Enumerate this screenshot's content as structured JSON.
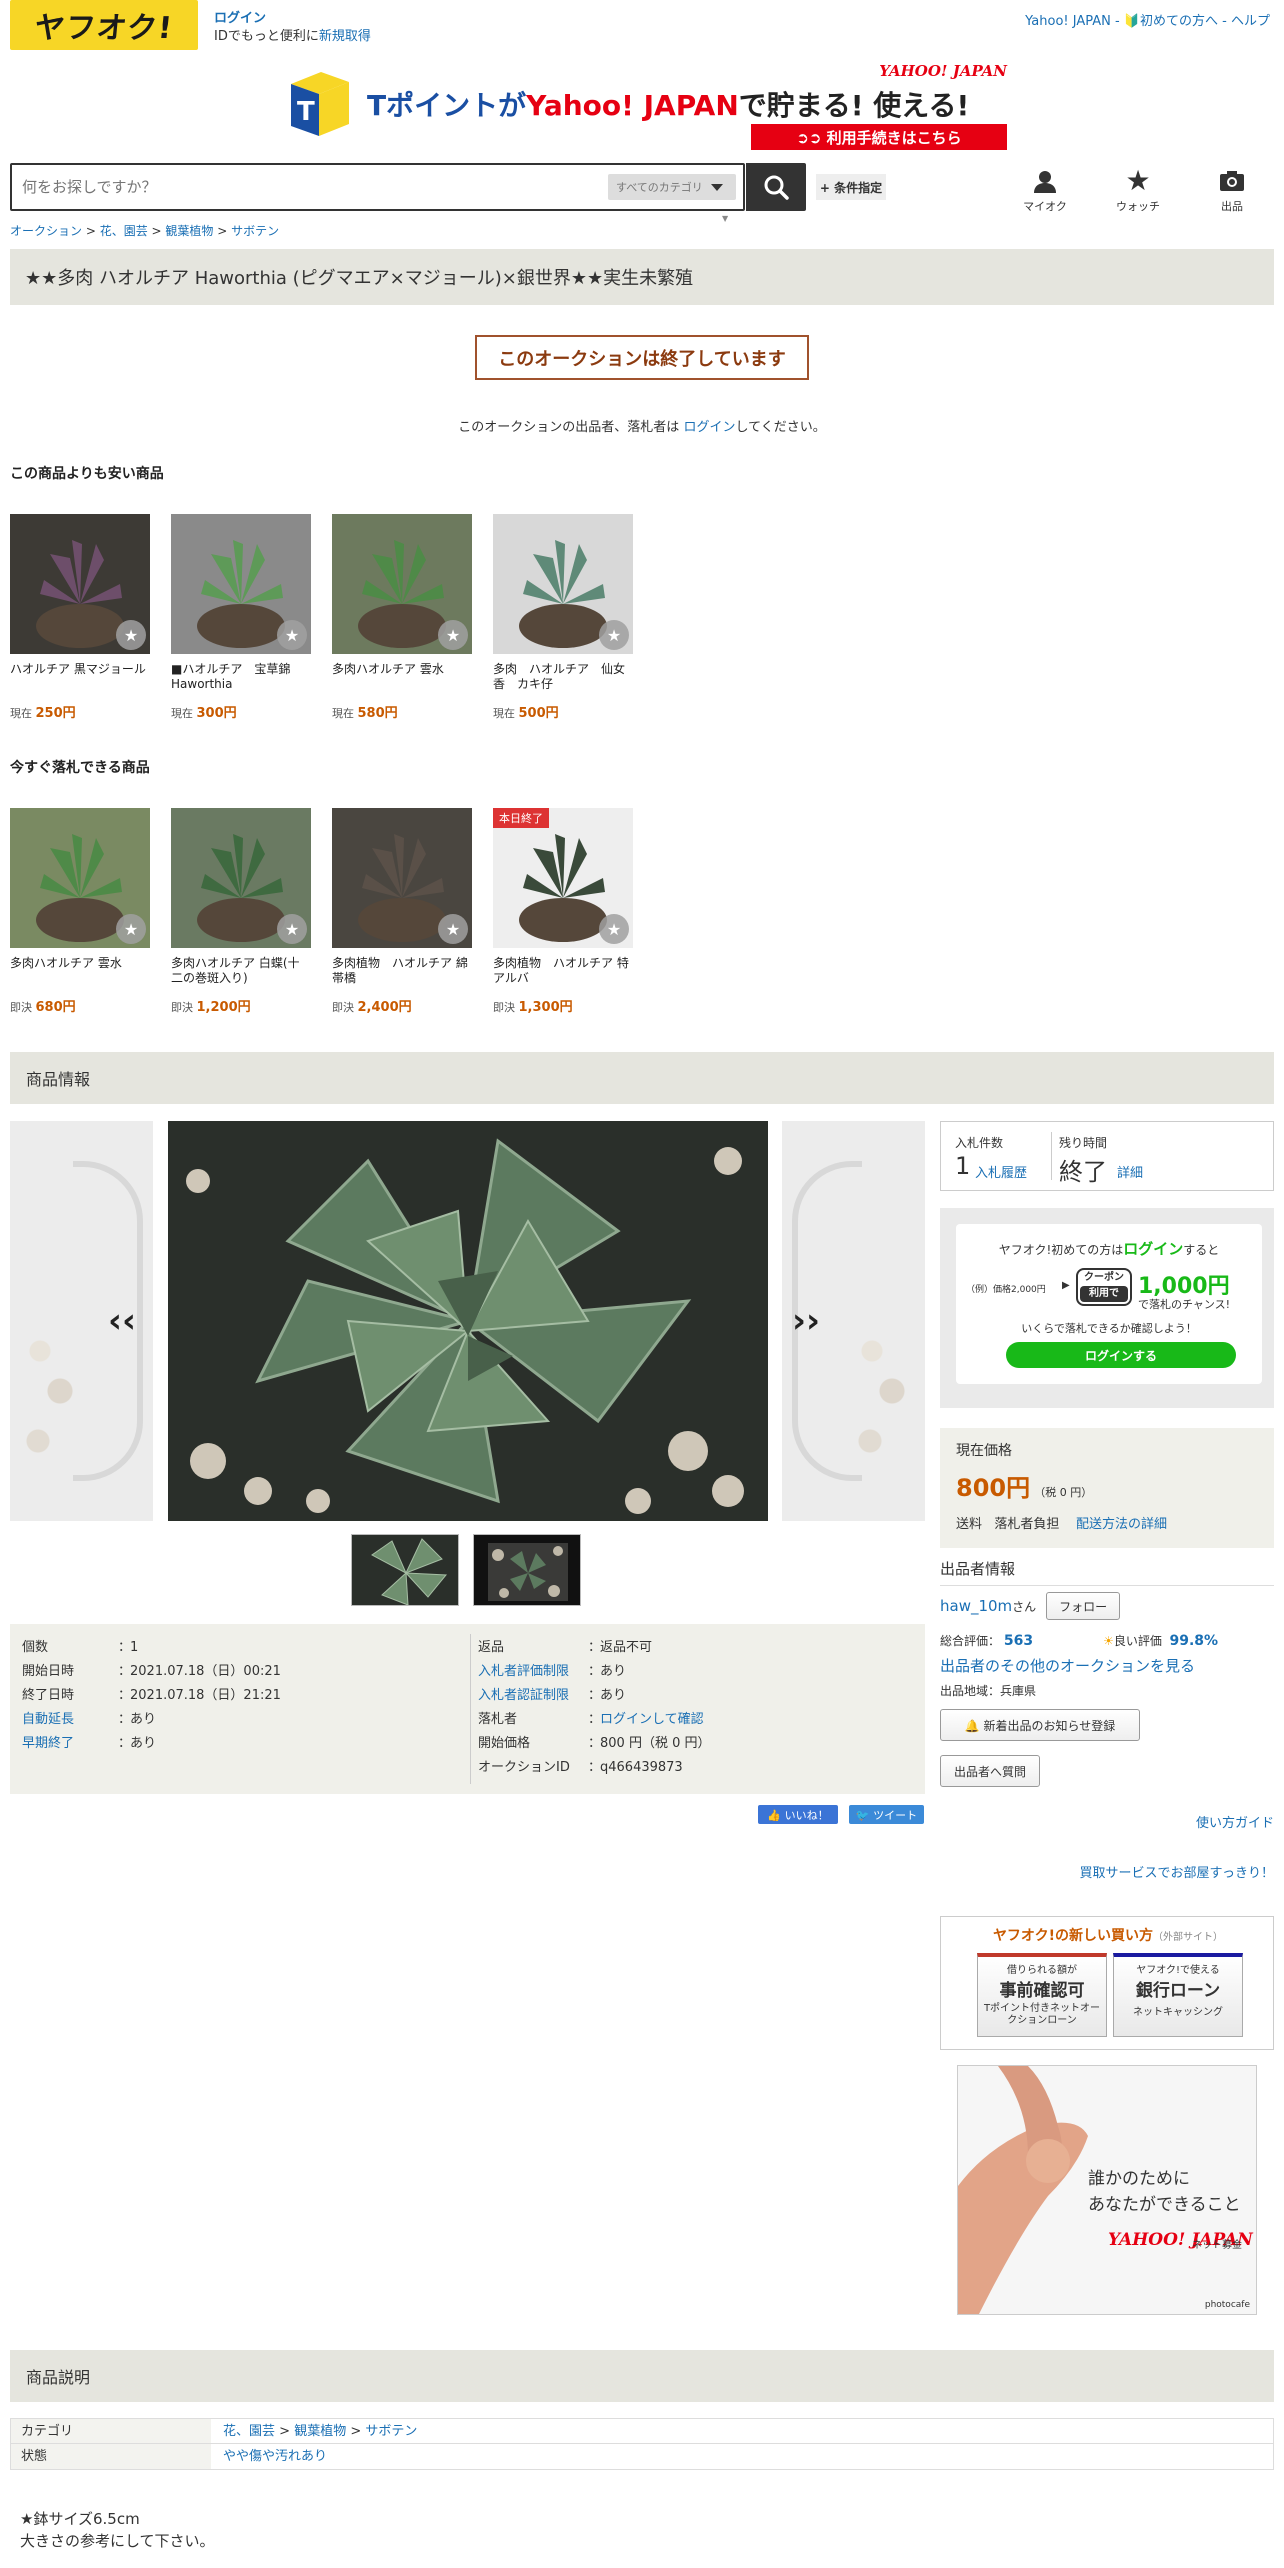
{
  "header": {
    "logo_text": "ヤフオク!",
    "login_link": "ログイン",
    "login_sub_prefix": "IDでもっと便利に",
    "signup_link": "新規取得",
    "right_links": "Yahoo! JAPAN - 🔰初めての方へ - ヘルプ"
  },
  "banner": {
    "brand": "YAHOO! JAPAN",
    "headline_a": "Tポイントが",
    "headline_b": "Yahoo! JAPAN",
    "headline_c": "で貯まる! 使える!",
    "cta": "➲➲ 利用手続きはこちら"
  },
  "search": {
    "placeholder": "何をお探しですか？",
    "category": "すべてのカテゴリ",
    "conditions": "+ 条件指定"
  },
  "nav": {
    "myauc": "マイオク",
    "watch": "ウォッチ",
    "sell": "出品"
  },
  "breadcrumb": [
    "オークション",
    "花、園芸",
    "観葉植物",
    "サボテン"
  ],
  "title": "★★多肉 ハオルチア Haworthia (ピグマエア×マジョール)×銀世界★★実生未繁殖",
  "ended_text": "このオークションは終了しています",
  "login_msg_a": "このオークションの出品者、落札者は",
  "login_msg_link": "ログイン",
  "login_msg_b": "してください。",
  "cheaper": {
    "heading": "この商品よりも安い商品",
    "items": [
      {
        "name": "ハオルチア 黒マジョール",
        "label": "現在",
        "price": "250円"
      },
      {
        "name": "■ハオルチア　宝草錦 Haworthia",
        "label": "現在",
        "price": "300円"
      },
      {
        "name": "多肉ハオルチア 雲水",
        "label": "現在",
        "price": "580円"
      },
      {
        "name": "多肉　ハオルチア　仙女香　カキ仔",
        "label": "現在",
        "price": "500円"
      }
    ]
  },
  "buynow": {
    "heading": "今すぐ落札できる商品",
    "items": [
      {
        "name": "多肉ハオルチア 雲水",
        "label": "即決",
        "price": "680円",
        "tag": ""
      },
      {
        "name": "多肉ハオルチア 白蝶(十二の巻斑入り)",
        "label": "即決",
        "price": "1,200円",
        "tag": ""
      },
      {
        "name": "多肉植物　ハオルチア 綿帯橋",
        "label": "即決",
        "price": "2,400円",
        "tag": ""
      },
      {
        "name": "多肉植物　ハオルチア 特アルバ",
        "label": "即決",
        "price": "1,300円",
        "tag": "本日終了"
      }
    ]
  },
  "info_heading": "商品情報",
  "specs_left": [
    {
      "k": "個数",
      "v": "1",
      "link": false
    },
    {
      "k": "開始日時",
      "v": "2021.07.18（日）00:21",
      "link": false
    },
    {
      "k": "終了日時",
      "v": "2021.07.18（日）21:21",
      "link": false
    },
    {
      "k": "自動延長",
      "v": "あり",
      "link": true
    },
    {
      "k": "早期終了",
      "v": "あり",
      "link": true
    }
  ],
  "specs_right": [
    {
      "k": "返品",
      "v": "返品不可",
      "link": false,
      "vlink": false
    },
    {
      "k": "入札者評価制限",
      "v": "あり",
      "link": true,
      "vlink": false
    },
    {
      "k": "入札者認証制限",
      "v": "あり",
      "link": true,
      "vlink": false
    },
    {
      "k": "落札者",
      "v": "ログインして確認",
      "link": false,
      "vlink": true
    },
    {
      "k": "開始価格",
      "v": "800 円（税 0 円）",
      "link": false,
      "vlink": false
    },
    {
      "k": "オークションID",
      "v": "q466439873",
      "link": false,
      "vlink": false
    }
  ],
  "share": {
    "like": "👍 いいね！",
    "tweet": "🐦 ツイート"
  },
  "bid": {
    "count_label": "入札件数",
    "count": "1",
    "history": "入札履歴",
    "time_label": "残り時間",
    "time": "終了",
    "detail": "詳細"
  },
  "promo": {
    "line1_a": "ヤフオク!初めての方は",
    "line1_b": "ログイン",
    "line1_c": "すると",
    "example": "（例）価格2,000円",
    "coupon_a": "クーポン",
    "coupon_b": "利用で",
    "amount": "1,000円",
    "chance": "で落札のチャンス!",
    "check": "いくらで落札できるか確認しよう！",
    "button": "ログインする"
  },
  "price": {
    "label": "現在価格",
    "value": "800円",
    "tax": "（税 0 円）",
    "shipping_a": "送料",
    "shipping_b": "落札者負担",
    "shipping_link": "配送方法の詳細"
  },
  "seller": {
    "heading": "出品者情報",
    "name": "haw_10m",
    "suffix": "さん",
    "follow": "フォロー",
    "total_label": "総合評価：",
    "total": "563",
    "good_label": "良い評価",
    "good": "99.8%",
    "other": "出品者のその他のオークションを見る",
    "region": "出品地域：兵庫県",
    "notify": "🔔 新着出品のお知らせ登録",
    "question": "出品者へ質問"
  },
  "guide": "使い方ガイド",
  "buyservice": "買取サービスでお部屋すっきり！",
  "way": {
    "title": "ヤフオク!の新しい買い方",
    "sub": "（外部サイト）",
    "c1_top": "借りられる額が",
    "c1_main": "事前確認可",
    "c1_sub": "Tポイント付きネットオークションローン",
    "c2_top": "ヤフオク!で使える",
    "c2_main": "銀行ローン",
    "c2_sub": "ネットキャッシング"
  },
  "charity": {
    "line1": "誰かのために",
    "line2": "あなたができること",
    "brand": "YAHOO! JAPAN",
    "brand_sub": "ネット募金",
    "credit": "photocafe"
  },
  "desc_heading": "商品説明",
  "desc_rows": [
    {
      "k": "カテゴリ",
      "v": ""
    },
    {
      "k": "状態",
      "v": "やや傷や汚れあり"
    }
  ],
  "desc_category_path": [
    "花、園芸",
    "観葉植物",
    "サボテン"
  ],
  "desc_text1": "★鉢サイズ6.5cm",
  "desc_text2": "大きさの参考にして下さい。",
  "colors": {
    "accent": "#c85a00",
    "link": "#1a6fb4",
    "green": "#18b918",
    "yellow": "#f7d626"
  }
}
